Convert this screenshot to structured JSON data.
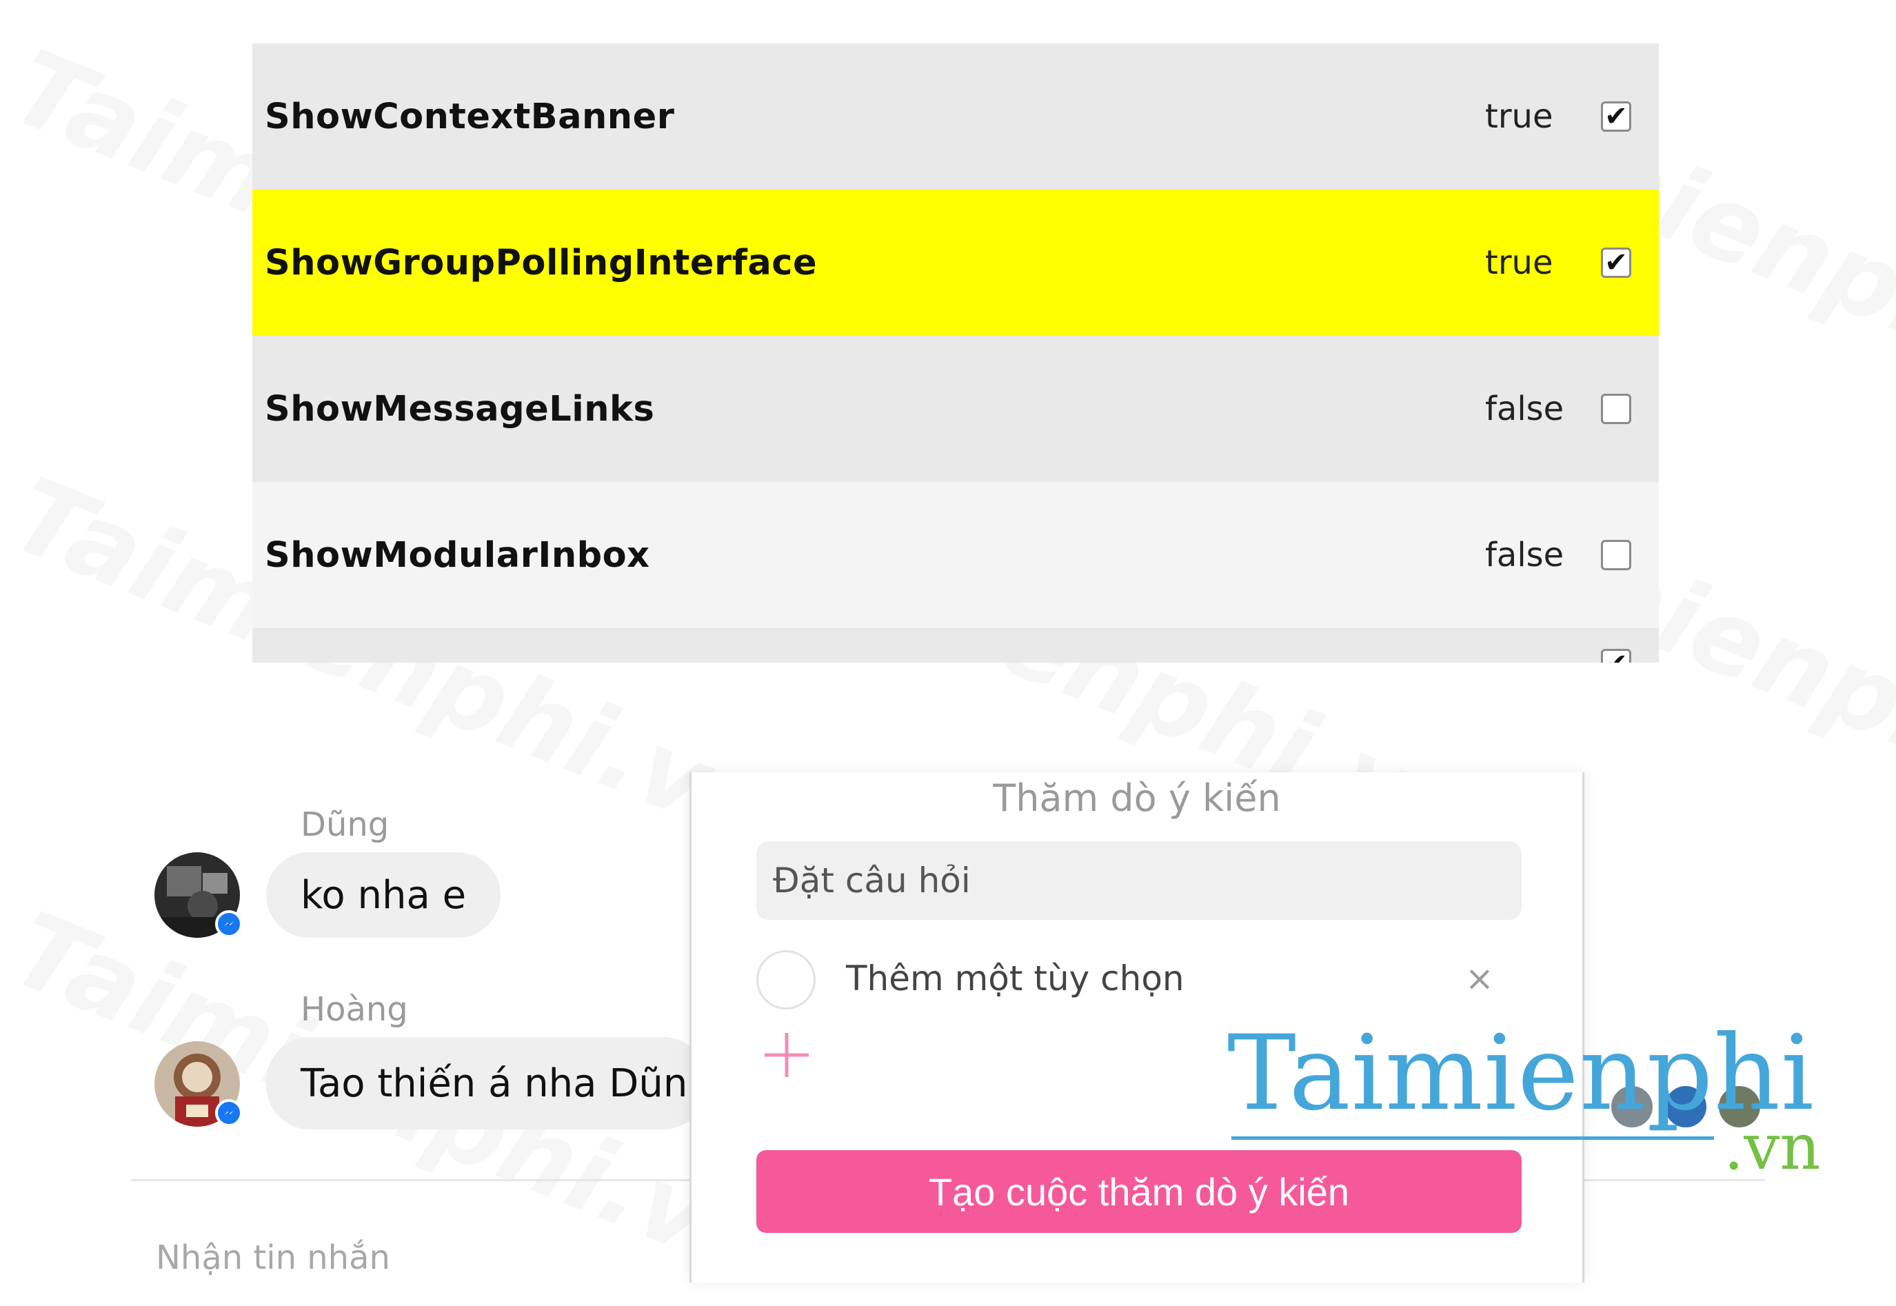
{
  "flags": [
    {
      "name": "ShowContextBanner",
      "value": "true",
      "checked": true,
      "highlighted": false,
      "bg": "#e9e9e9"
    },
    {
      "name": "ShowGroupPollingInterface",
      "value": "true",
      "checked": true,
      "highlighted": true,
      "bg": "#ffff00"
    },
    {
      "name": "ShowMessageLinks",
      "value": "false",
      "checked": false,
      "highlighted": false,
      "bg": "#e9e9e9"
    },
    {
      "name": "ShowModularInbox",
      "value": "false",
      "checked": false,
      "highlighted": false,
      "bg": "#f4f4f4"
    },
    {
      "name": "",
      "value": "",
      "checked": true,
      "highlighted": false,
      "bg": "#e9e9e9"
    }
  ],
  "chat": {
    "messages": [
      {
        "sender": "Dũng",
        "text": "ko nha e"
      },
      {
        "sender": "Hoàng",
        "text": "Tao thiến á nha Dũng"
      }
    ],
    "composer_placeholder": "Nhận tin nhắn"
  },
  "poll": {
    "title": "Thăm dò ý kiến",
    "question_placeholder": "Đặt câu hỏi",
    "option_placeholder": "Thêm một tùy chọn",
    "remove_symbol": "×",
    "create_label": "Tạo cuộc thăm dò ý kiến",
    "accent_color": "#f5599a"
  },
  "watermark": {
    "brand": "Taimienphi",
    "suffix": ".vn",
    "faint_text": "Taimienphi.vn"
  },
  "colors": {
    "highlight": "#ffff00",
    "messenger_badge": "#1877f2",
    "brand_blue": "#45a6da",
    "brand_green": "#74c044"
  }
}
